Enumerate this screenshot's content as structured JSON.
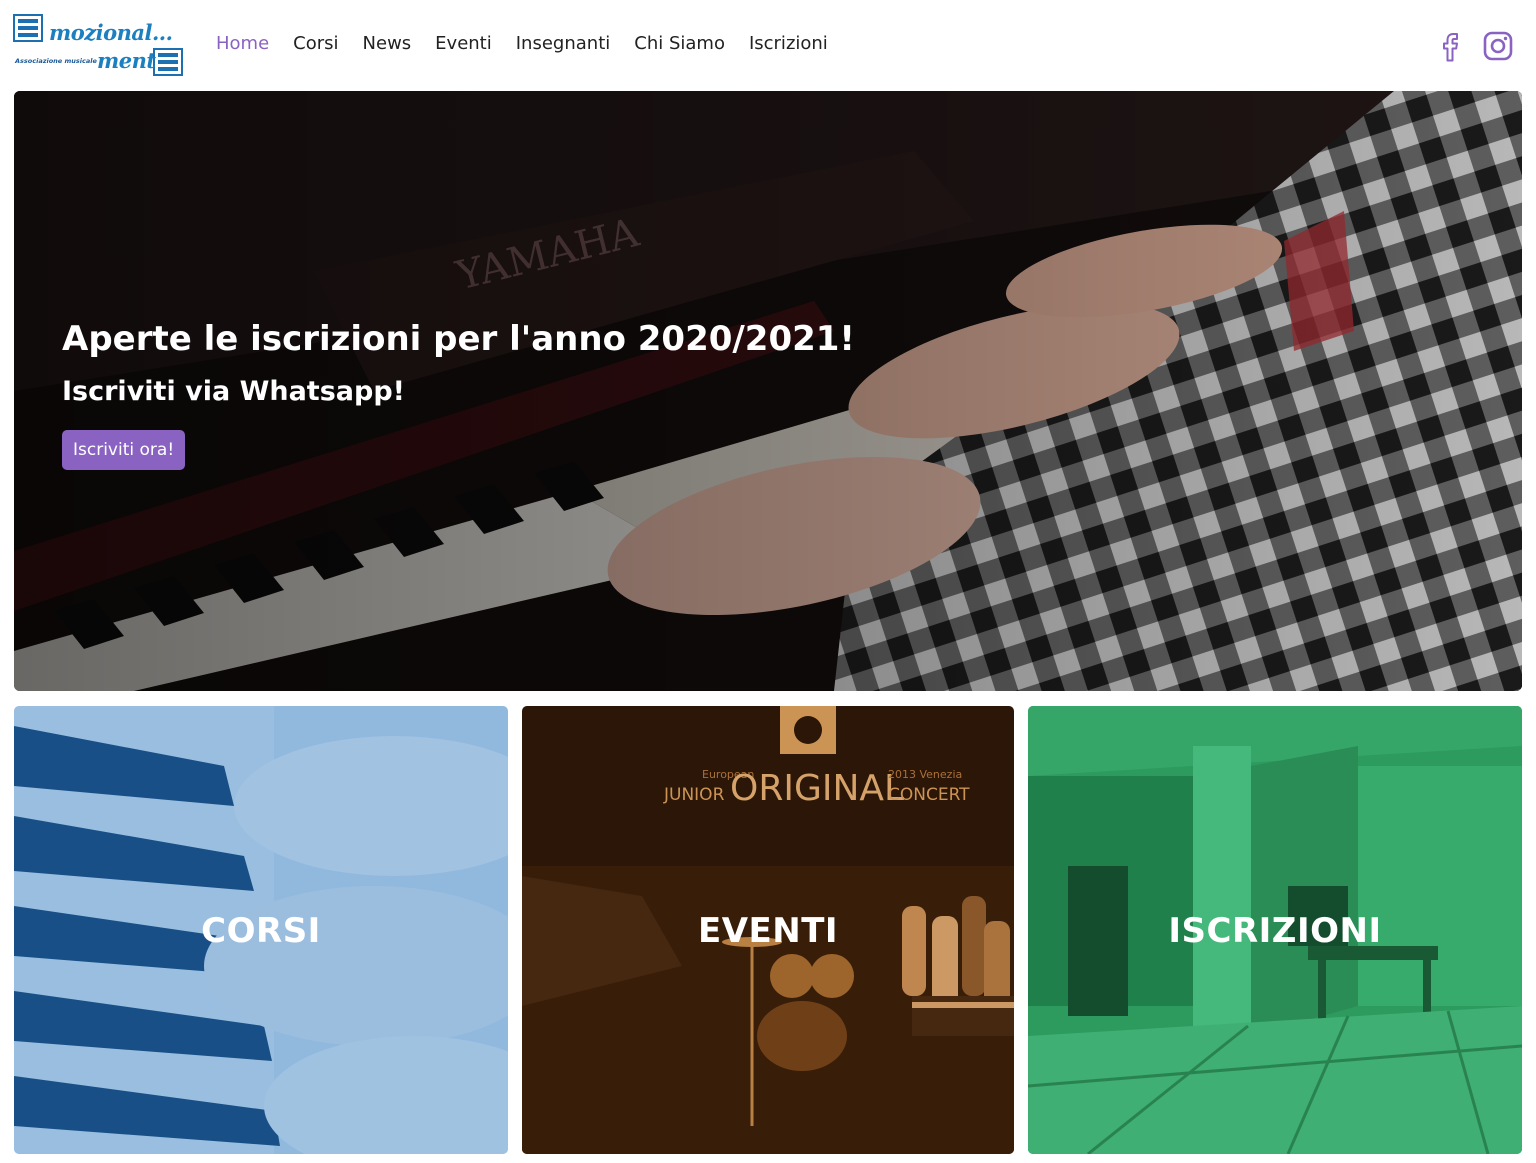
{
  "logo": {
    "line1": "mozional...",
    "line2": "ment",
    "subtitle": "Associazione musicale"
  },
  "nav": {
    "items": [
      {
        "label": "Home",
        "active": true
      },
      {
        "label": "Corsi",
        "active": false
      },
      {
        "label": "News",
        "active": false
      },
      {
        "label": "Eventi",
        "active": false
      },
      {
        "label": "Insegnanti",
        "active": false
      },
      {
        "label": "Chi Siamo",
        "active": false
      },
      {
        "label": "Iscrizioni",
        "active": false
      }
    ]
  },
  "social": {
    "facebook_icon": "facebook-icon",
    "instagram_icon": "instagram-icon",
    "color": "#8a63c2"
  },
  "hero": {
    "title": "Aperte le iscrizioni per l'anno 2020/2021!",
    "subtitle": "Iscriviti via Whatsapp!",
    "button_label": "Iscriviti ora!",
    "piano_brand": "YAMAHA"
  },
  "cards": [
    {
      "label": "CORSI",
      "tint": "#1e6fb8"
    },
    {
      "label": "EVENTI",
      "tint": "#8a4d17"
    },
    {
      "label": "ISCRIZIONI",
      "tint": "#2a9a5c"
    }
  ],
  "event_banner": {
    "line_left_1": "European",
    "line_left_2": "JUNIOR",
    "big": "ORIGINAL",
    "line_right_1": "2013 Venezia",
    "line_right_2": "CONCERT"
  },
  "colors": {
    "accent": "#8a63c2",
    "logo_blue": "#1c7fc0"
  }
}
